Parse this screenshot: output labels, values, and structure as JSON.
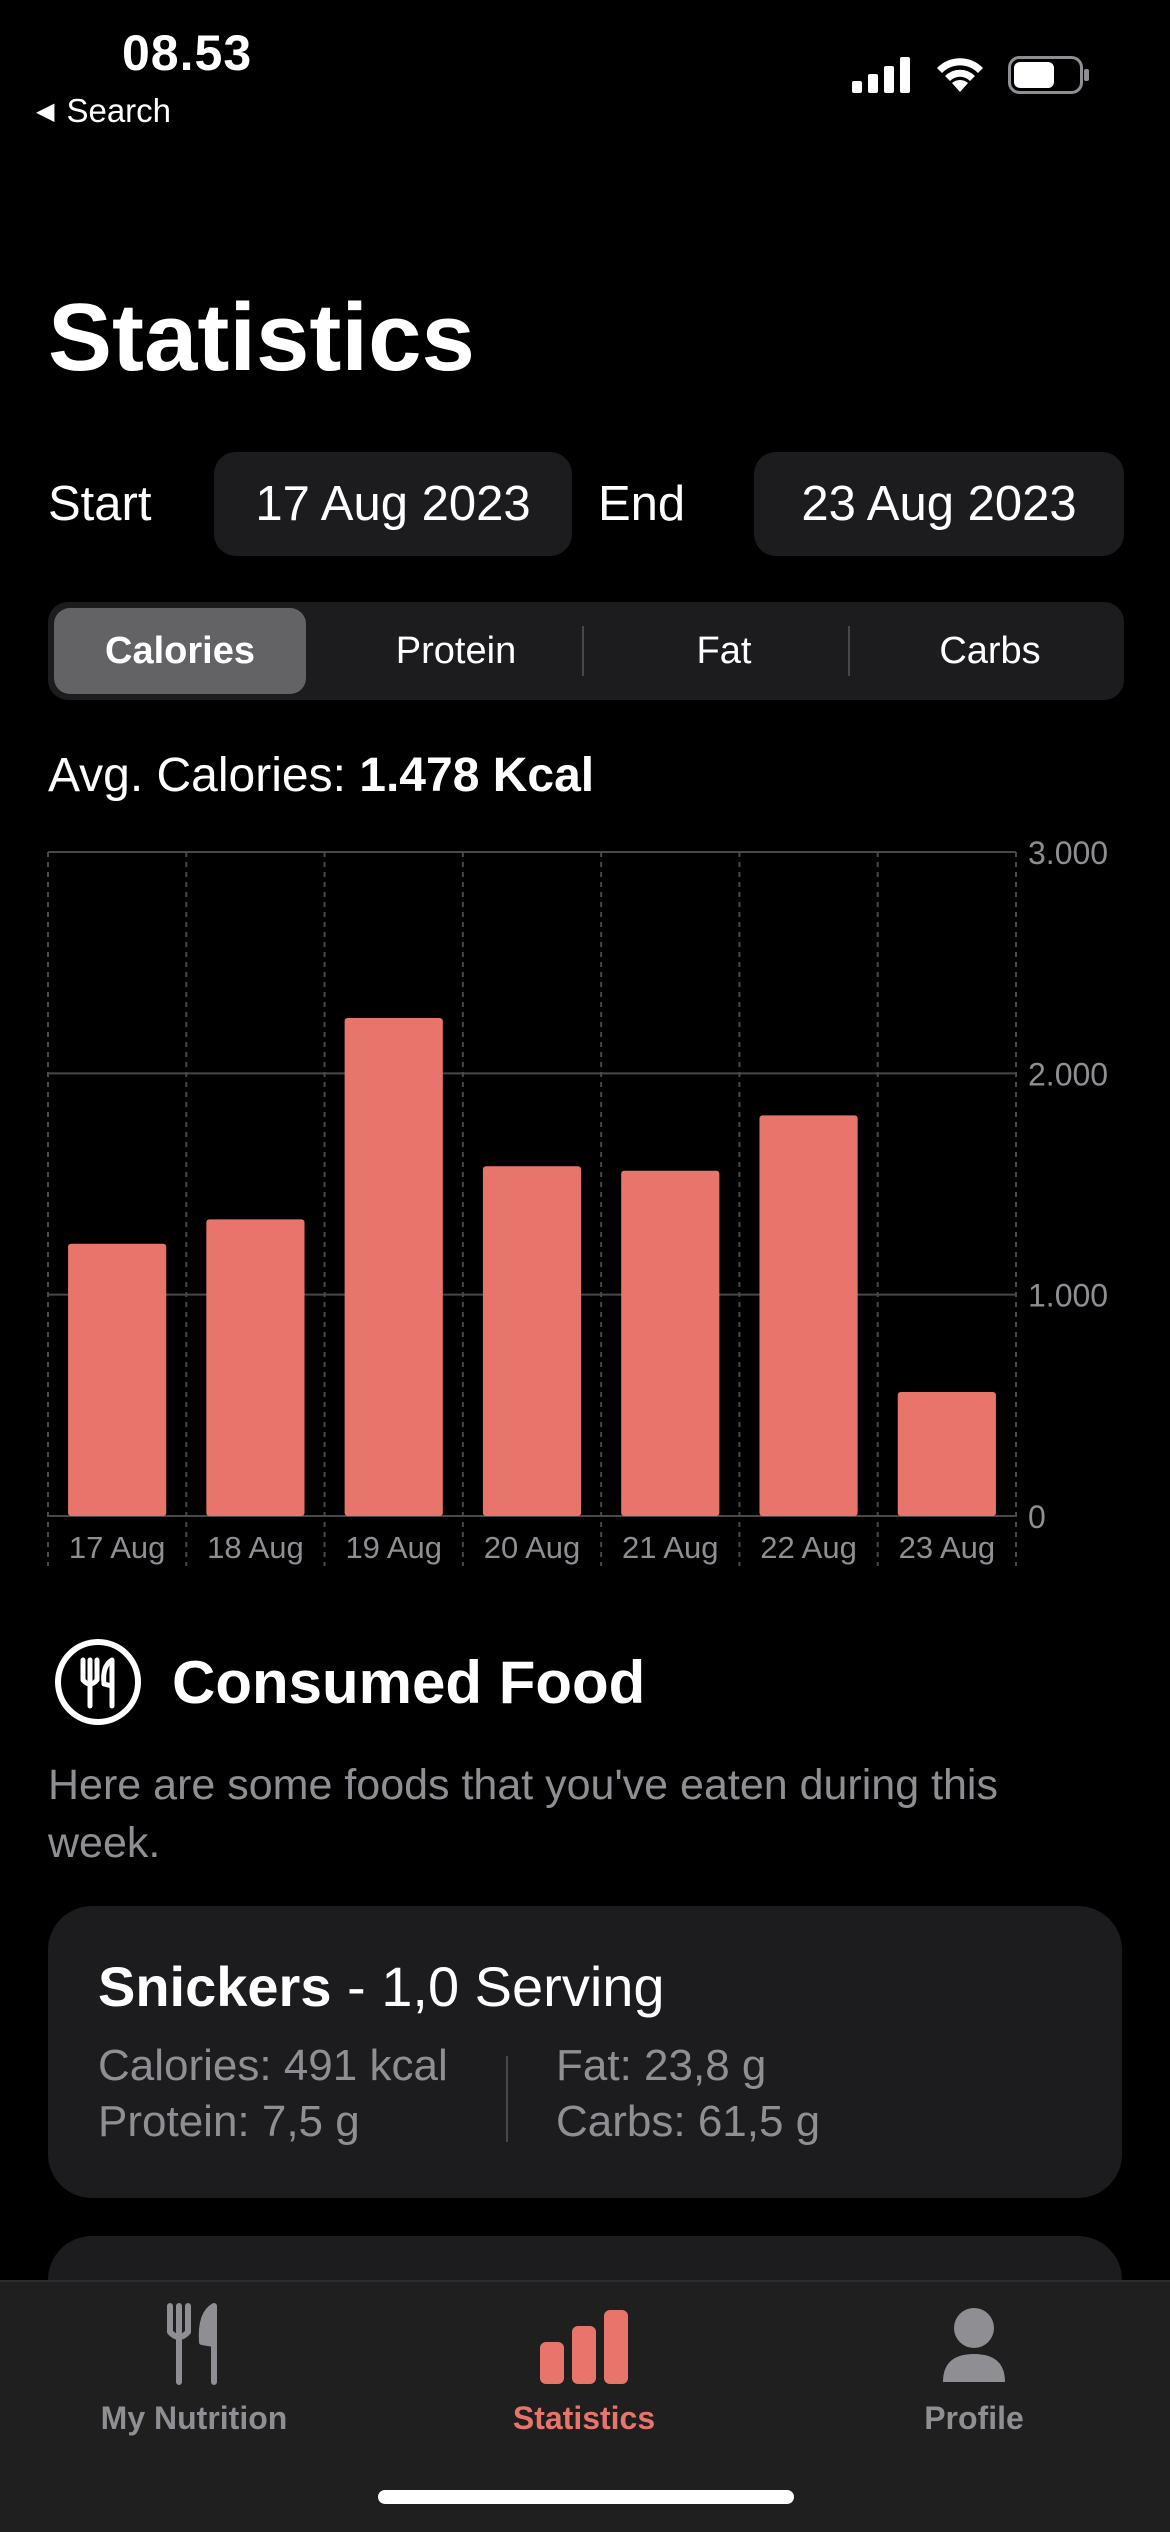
{
  "status_bar": {
    "time": "08.53",
    "back_label": "Search"
  },
  "page": {
    "title": "Statistics"
  },
  "date_range": {
    "start_label": "Start",
    "start_value": "17 Aug 2023",
    "end_label": "End",
    "end_value": "23 Aug 2023"
  },
  "segments": [
    {
      "label": "Calories",
      "selected": true
    },
    {
      "label": "Protein",
      "selected": false
    },
    {
      "label": "Fat",
      "selected": false
    },
    {
      "label": "Carbs",
      "selected": false
    }
  ],
  "average": {
    "label": "Avg. Calories:",
    "value": "1.478 Kcal"
  },
  "chart_data": {
    "type": "bar",
    "categories": [
      "17 Aug",
      "18 Aug",
      "19 Aug",
      "20 Aug",
      "21 Aug",
      "22 Aug",
      "23 Aug"
    ],
    "values": [
      1230,
      1340,
      2250,
      1580,
      1560,
      1810,
      560
    ],
    "ylim": [
      0,
      3000
    ],
    "y_ticks": [
      0,
      1000,
      2000,
      3000
    ],
    "y_tick_labels": [
      "0",
      "1.000",
      "2.000",
      "3.000"
    ],
    "y_axis_position": "right",
    "grid": true,
    "bar_color": "#e8756c"
  },
  "consumed_section": {
    "title": "Consumed Food",
    "description": "Here are some foods that you've eaten during this week.",
    "icon": "fork-knife-icon"
  },
  "foods": [
    {
      "name": "Snickers",
      "separator": " - ",
      "serving": "1,0 Serving",
      "calories": "Calories: 491 kcal",
      "protein": "Protein: 7,5 g",
      "fat": "Fat: 23,8 g",
      "carbs": "Carbs: 61,5 g"
    }
  ],
  "tab_bar": {
    "items": [
      {
        "label": "My Nutrition",
        "icon": "fork-knife-icon",
        "active": false
      },
      {
        "label": "Statistics",
        "icon": "bar-chart-icon",
        "active": true
      },
      {
        "label": "Profile",
        "icon": "person-icon",
        "active": false
      }
    ],
    "active_color": "#e8756c",
    "inactive_color": "#8e8e93"
  }
}
